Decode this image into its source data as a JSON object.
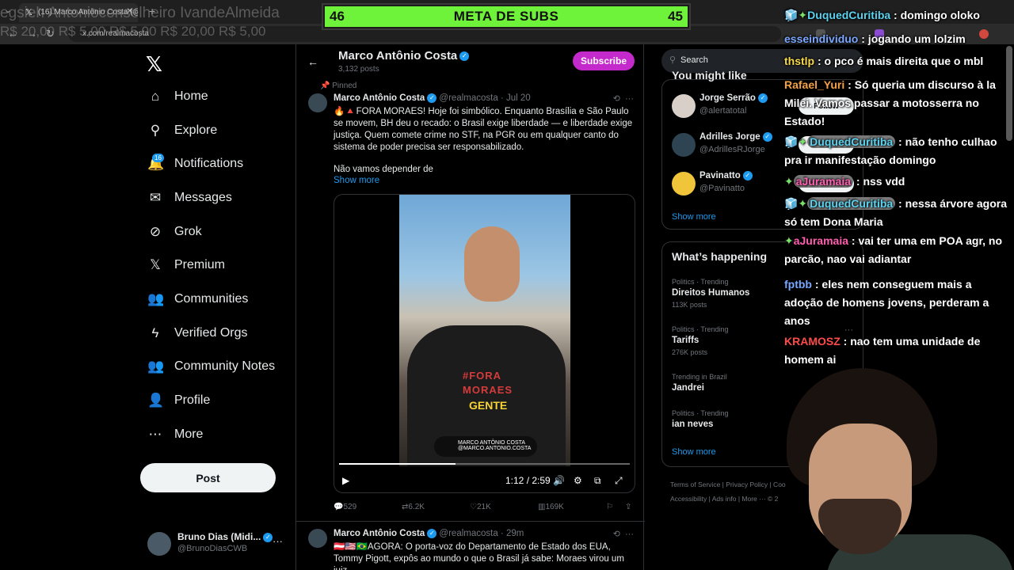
{
  "browser": {
    "tab_title": "(16) Marco Antônio Costa (@re...",
    "url": "x.com/realmacosta"
  },
  "overlay": {
    "names": "egsieh  Antonioconselheiro  IvandeAlmeida",
    "prices": "R$ 20,00  R$ 5,00       R$ 5,00             R$ 20,00   R$ 5,00"
  },
  "goal": {
    "left": "46",
    "title": "META DE SUBS",
    "right": "45"
  },
  "sidebar": {
    "items": [
      {
        "label": "Home",
        "icon": "home-icon",
        "glyph": "⌂"
      },
      {
        "label": "Explore",
        "icon": "search-icon",
        "glyph": "⚲"
      },
      {
        "label": "Notifications",
        "icon": "bell-icon",
        "glyph": "🔔"
      },
      {
        "label": "Messages",
        "icon": "envelope-icon",
        "glyph": "✉"
      },
      {
        "label": "Grok",
        "icon": "grok-icon",
        "glyph": "⊘"
      },
      {
        "label": "Premium",
        "icon": "x-premium-icon",
        "glyph": "𝕏"
      },
      {
        "label": "Communities",
        "icon": "communities-icon",
        "glyph": "👥"
      },
      {
        "label": "Verified Orgs",
        "icon": "lightning-icon",
        "glyph": "ϟ"
      },
      {
        "label": "Community Notes",
        "icon": "community-notes-icon",
        "glyph": "👥"
      },
      {
        "label": "Profile",
        "icon": "profile-icon",
        "glyph": "👤"
      },
      {
        "label": "More",
        "icon": "more-icon",
        "glyph": "⋯"
      }
    ],
    "notif_count": "16",
    "post_label": "Post",
    "account": {
      "name": "Bruno Dias (Midi...",
      "handle": "@BrunoDiasCWB"
    }
  },
  "profile": {
    "name": "Marco Antônio Costa",
    "posts": "3,132 posts",
    "subscribe": "Subscribe"
  },
  "pinned_label": "Pinned",
  "posts": [
    {
      "name": "Marco Antônio Costa",
      "meta": "@realmacosta · Jul 20",
      "text": "🔥🔺FORA MORAES! Hoje foi simbólico. Enquanto Brasília e São Paulo se movem, BH deu o recado: o Brasil exige liberdade — e liberdade exige justiça. Quem comete crime no STF, na PGR ou em qualquer canto do sistema de poder precisa ser responsabilizado.",
      "text2": "Não vamos depender de",
      "show_more": "Show more",
      "video": {
        "shirt_text": "#FORA MORAES",
        "caption": "GENTE",
        "tag_name": "MARCO ANTÔNIO COSTA",
        "tag_handle": "@MARCO.ANTONIO.COSTA",
        "time": "1:12 / 2:59",
        "progress": 0.4
      },
      "replies": "529",
      "reposts": "6.2K",
      "likes": "21K",
      "views": "169K"
    },
    {
      "name": "Marco Antônio Costa",
      "meta": "@realmacosta · 29m",
      "text": "🇦🇹🇺🇸🇧🇷AGORA:  O porta-voz do Departamento de Estado dos EUA, Tommy Pigott, expôs ao mundo o que o Brasil já sabe: Moraes virou um juiz"
    }
  ],
  "right": {
    "search_placeholder": "Search",
    "suggest_title": "You might like",
    "suggestions": [
      {
        "name": "Jorge Serrão",
        "handle": "@alertatotal",
        "follow": "Follow"
      },
      {
        "name": "Adrilles Jorge",
        "handle": "@AdrillesRJorge",
        "follow": "Follow"
      },
      {
        "name": "Pavinatto",
        "handle": "@Pavinatto",
        "follow": "Follow"
      }
    ],
    "show_more": "Show more",
    "happening_title": "What’s happening",
    "trends": [
      {
        "cat": "Politics · Trending",
        "name": "Direitos Humanos",
        "count": "113K posts"
      },
      {
        "cat": "Politics · Trending",
        "name": "Tariffs",
        "count": "276K posts"
      },
      {
        "cat": "Trending in Brazil",
        "name": "Jandrei",
        "count": ""
      },
      {
        "cat": "Politics · Trending",
        "name": "ian neves",
        "count": ""
      }
    ],
    "trends_show_more": "Show more",
    "footer1": "Terms of Service   |   Privacy Policy   |   Coo",
    "footer2": "Accessibility   |   Ads info   |   More ···  © 2"
  },
  "chat": [
    {
      "user": "DuquedCuritiba",
      "color": "#5ad2f0",
      "text": " : domingo oloko",
      "badges": "🧊✦"
    },
    {
      "user": "esseindividuo",
      "color": "#7aa7ff",
      "text": " : jogando um lolzim",
      "badges": ""
    },
    {
      "user": "thstlp",
      "color": "#f7d84a",
      "text": " : o pco é mais direita que o mbl",
      "badges": ""
    },
    {
      "user": "Rafael_Yuri",
      "color": "#f5a142",
      "text": " : Só queria um discurso à la Milei. Vamos passar a motosserra no Estado!",
      "badges": ""
    },
    {
      "user": "DuquedCuritiba",
      "color": "#5ad2f0",
      "text": " : não tenho culhao pra ir manifestação domingo",
      "badges": "🧊✦"
    },
    {
      "user": "aJuramaia",
      "color": "#ff5fb0",
      "text": " : nss vdd",
      "badges": "✦"
    },
    {
      "user": "DuquedCuritiba",
      "color": "#5ad2f0",
      "text": " : nessa árvore agora só tem Dona Maria",
      "badges": "🧊✦"
    },
    {
      "user": "aJuramaia",
      "color": "#ff5fb0",
      "text": " : vai ter uma em POA agr, no parcão, nao vai adiantar",
      "badges": "✦"
    },
    {
      "user": "fptbb",
      "color": "#7aa7ff",
      "text": " : eles nem conseguem mais a adoção de homens jovens, perderam a anos",
      "badges": ""
    },
    {
      "user": "KRAMOSZ",
      "color": "#ff4a4a",
      "text": " : nao tem uma unidade de homem ai",
      "badges": ""
    }
  ]
}
